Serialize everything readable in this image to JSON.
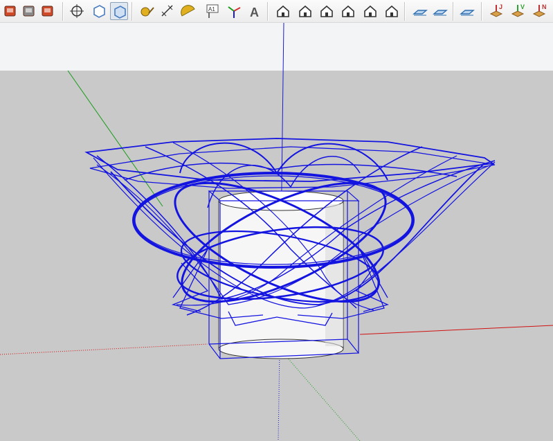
{
  "window": {
    "viewport": "model-viewport"
  },
  "toolbar": {
    "buttons": [
      {
        "name": "components-icon",
        "color": "#d04a2a"
      },
      {
        "name": "dynamic-components-icon",
        "color": "#8a8a8a"
      },
      {
        "name": "get-models-icon",
        "color": "#d04a2a"
      },
      {
        "name": "orbit-icon",
        "color": "#333333"
      },
      {
        "name": "wireframe-style-icon",
        "color": "#4a7cc0"
      },
      {
        "name": "xray-style-icon",
        "color": "#4a7cc0",
        "active": true
      },
      {
        "name": "tape-measure-icon",
        "color": "#e0b020"
      },
      {
        "name": "dimension-icon",
        "color": "#333333"
      },
      {
        "name": "protractor-icon",
        "color": "#e0b020"
      },
      {
        "name": "text-label-icon",
        "color": "#333333",
        "label": "A1"
      },
      {
        "name": "axes-icon",
        "color": "#d23030"
      },
      {
        "name": "3d-text-icon",
        "color": "#555555"
      },
      {
        "name": "iso-view-icon",
        "color": "#333333"
      },
      {
        "name": "top-view-icon",
        "color": "#333333"
      },
      {
        "name": "front-view-icon",
        "color": "#333333"
      },
      {
        "name": "right-view-icon",
        "color": "#333333"
      },
      {
        "name": "back-view-icon",
        "color": "#333333"
      },
      {
        "name": "left-view-icon",
        "color": "#333333"
      },
      {
        "name": "section-plane-icon",
        "color": "#2f6fb0"
      },
      {
        "name": "display-section-planes-icon",
        "color": "#2f6fb0"
      },
      {
        "name": "display-section-cuts-icon",
        "color": "#2f6fb0"
      },
      {
        "name": "solar-north-j-icon",
        "color": "#c03030",
        "label": "J"
      },
      {
        "name": "solar-north-v-icon",
        "color": "#30a030",
        "label": "V"
      },
      {
        "name": "solar-north-n-icon",
        "color": "#c03030",
        "label": "N"
      }
    ]
  },
  "colors": {
    "sky": "#f3f4f6",
    "ground": "#c9c9c9",
    "wire": "#1414e0",
    "axis_red": "#d01010",
    "axis_green": "#1a9a1a",
    "axis_blue": "#1a1ad0"
  }
}
